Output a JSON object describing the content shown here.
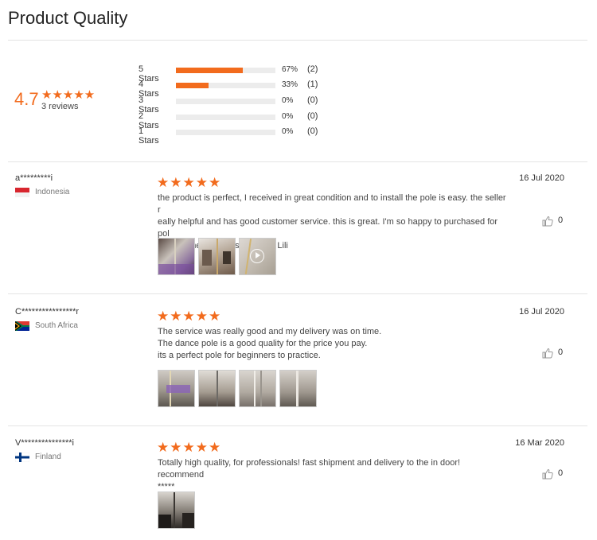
{
  "page": {
    "title": "Product Quality"
  },
  "summary": {
    "average": "4.7",
    "average_value": 4.7,
    "stars_glyphs": "★★★★★",
    "count_text": "3 reviews",
    "accent_color": "#f26b1d",
    "distribution": [
      {
        "label": "5 Stars",
        "percent_text": "67%",
        "count_text": "(2)",
        "fraction": 0.67
      },
      {
        "label": "4 Stars",
        "percent_text": "33%",
        "count_text": "(1)",
        "fraction": 0.33
      },
      {
        "label": "3 Stars",
        "percent_text": "0%",
        "count_text": "(0)",
        "fraction": 0
      },
      {
        "label": "2 Stars",
        "percent_text": "0%",
        "count_text": "(0)",
        "fraction": 0
      },
      {
        "label": "1 Stars",
        "percent_text": "0%",
        "count_text": "(0)",
        "fraction": 0
      }
    ]
  },
  "reviews": [
    {
      "reviewer": "a*********i",
      "country": "Indonesia",
      "flag_icon": "indonesia-flag-icon",
      "stars": "★★★★★",
      "rating": 5,
      "date": "16 Jul 2020",
      "text_lines": [
        "the product is perfect, I received in great condition and to install the pole is easy. the seller r",
        "eally helpful and has good customer service. this is great. I'm so happy to purchased for pol",
        "e dance here. thanks so much Lili"
      ],
      "likes": "0",
      "thumbnails": [
        "photo",
        "photo",
        "video"
      ]
    },
    {
      "reviewer": "C****************r",
      "country": "South Africa",
      "flag_icon": "south-africa-flag-icon",
      "stars": "★★★★★",
      "rating": 5,
      "date": "16 Jul 2020",
      "text_lines": [
        "The service was really good and my delivery was on time.",
        "The dance pole is a good quality for the price you pay.",
        "its a perfect pole for beginners to practice."
      ],
      "likes": "0",
      "thumbnails": [
        "photo",
        "photo",
        "photo",
        "photo"
      ]
    },
    {
      "reviewer": "V***************i",
      "country": "Finland",
      "flag_icon": "finland-flag-icon",
      "stars": "★★★★★",
      "rating": 5,
      "date": "16 Mar 2020",
      "text_lines": [
        "Totally high quality, for professionals! fast shipment and delivery to the in door! recommend",
        "*****"
      ],
      "likes": "0",
      "thumbnails": [
        "photo"
      ]
    }
  ]
}
